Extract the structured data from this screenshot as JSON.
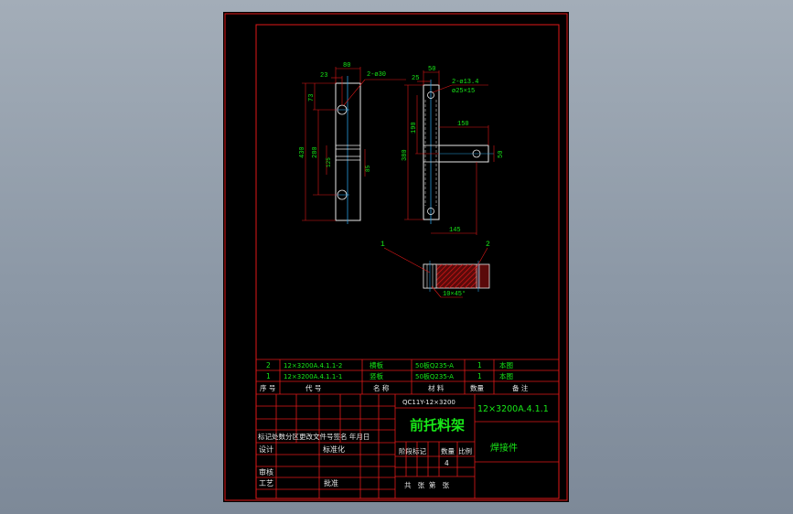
{
  "drawing": {
    "part_views": {
      "view1": {
        "dims": {
          "d80": "80",
          "d23": "23",
          "d73": "73",
          "d430": "430",
          "d280": "280",
          "d125": "125",
          "d85": "85"
        },
        "hole_note": "2-ø30"
      },
      "view2": {
        "dims": {
          "d50": "50",
          "d25": "25",
          "d190": "190",
          "d380": "380",
          "d150": "150",
          "d50b": "50",
          "d145": "145"
        },
        "hole_note_1": "2-ø13.4",
        "hole_note_2": "ø25×15"
      },
      "section_view": {
        "label_1": "1",
        "label_2": "2",
        "weld_note": "10×45°"
      }
    },
    "bom": {
      "rows": [
        {
          "seq": "2",
          "code": "12×3200A.4.1.1-2",
          "name": "横板",
          "material": "50板Q235-A",
          "qty": "1",
          "note": "本图"
        },
        {
          "seq": "1",
          "code": "12×3200A.4.1.1-1",
          "name": "竖板",
          "material": "50板Q235-A",
          "qty": "1",
          "note": "本图"
        }
      ],
      "headers": {
        "seq": "序 号",
        "code": "代 号",
        "name": "名 称",
        "qty_label": "数量",
        "material": "材 料",
        "remark": "备 注"
      }
    },
    "title_block": {
      "model": "QC11Y-12×3200",
      "part_title": "前托料架",
      "drawing_no": "12×3200A.4.1.1",
      "type_label": "焊接件",
      "rev_header": "标记处数分区更改文件号签名 年月日",
      "design": "设计",
      "standardize": "标准化",
      "review": "审核",
      "process": "工艺",
      "approve": "批准",
      "stage_mark": "阶段标记",
      "weight": "数量",
      "scale": "比例",
      "qty_value": "4",
      "sheets": "共   张  第   张"
    }
  }
}
